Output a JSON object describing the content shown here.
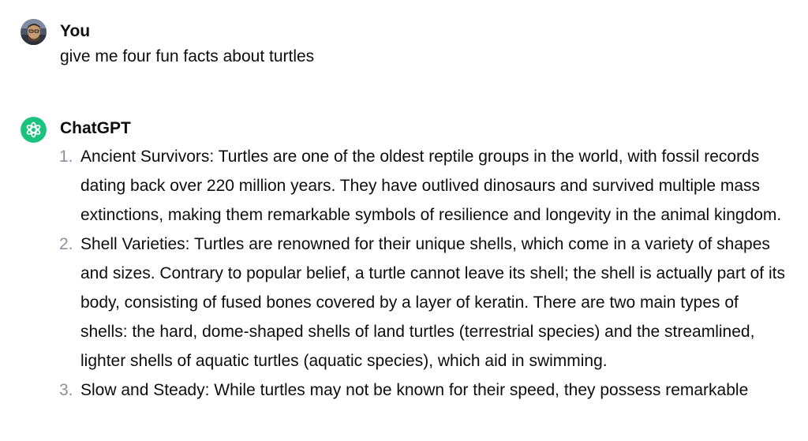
{
  "user_message": {
    "author": "You",
    "text": "give me four fun facts about turtles"
  },
  "assistant_message": {
    "author": "ChatGPT",
    "items": [
      {
        "number": "1.",
        "text": "Ancient Survivors: Turtles are one of the oldest reptile groups in the world, with fossil records dating back over 220 million years. They have outlived dinosaurs and survived multiple mass extinctions, making them remarkable symbols of resilience and longevity in the animal kingdom."
      },
      {
        "number": "2.",
        "text": "Shell Varieties: Turtles are renowned for their unique shells, which come in a variety of shapes and sizes. Contrary to popular belief, a turtle cannot leave its shell; the shell is actually part of its body, consisting of fused bones covered by a layer of keratin. There are two main types of shells: the hard, dome-shaped shells of land turtles (terrestrial species) and the streamlined, lighter shells of aquatic turtles (aquatic species), which aid in swimming."
      },
      {
        "number": "3.",
        "text": "Slow and Steady: While turtles may not be known for their speed, they possess remarkable"
      }
    ]
  },
  "colors": {
    "assistant_icon_bg": "#19c37d",
    "list_number": "#8e8ea0"
  },
  "icons": {
    "user_avatar": "user-avatar-photo",
    "assistant_avatar": "openai-logo-icon"
  }
}
